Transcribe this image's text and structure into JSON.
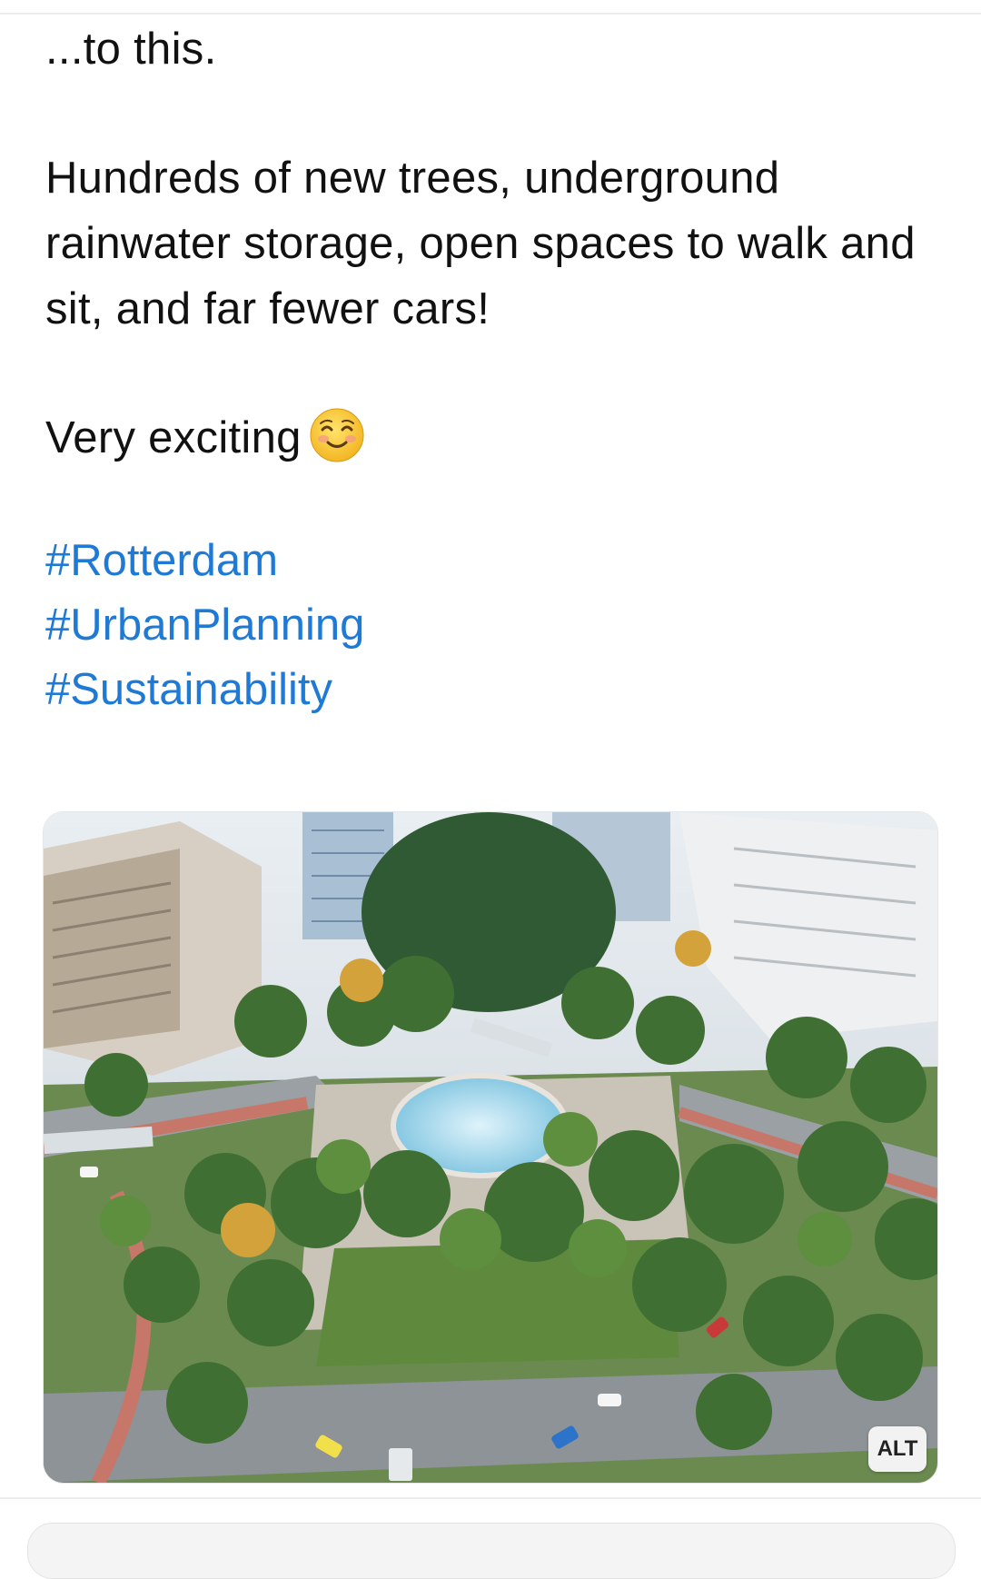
{
  "post": {
    "intro": "...to this.",
    "body": "Hundreds of new trees, underground rainwater storage, open spaces to walk and sit, and far fewer cars!",
    "closing": "Very exciting",
    "emoji_icon": "smiling-face-with-blush-emoji",
    "hashtags": [
      "#Rotterdam",
      "#UrbanPlanning",
      "#Sustainability"
    ]
  },
  "media": {
    "alt_label": "ALT"
  },
  "colors": {
    "hashtag": "#1f7ad6",
    "background": "#ffffff",
    "text": "#111111"
  }
}
